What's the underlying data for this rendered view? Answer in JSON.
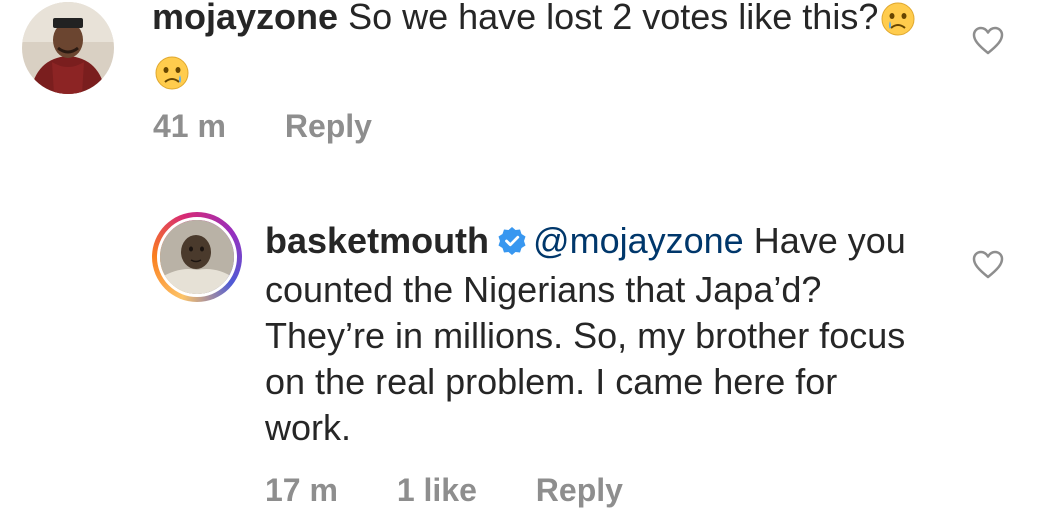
{
  "comments": [
    {
      "username": "mojayzone",
      "text": "So we have lost 2 votes like this?",
      "emojis": [
        "crying-face",
        "crying-face"
      ],
      "time": "41 m",
      "reply_label": "Reply"
    },
    {
      "username": "basketmouth",
      "verified": true,
      "mention": "@mojayzone",
      "text": "Have you counted the Nigerians that Japa’d? They’re in millions. So, my brother focus on the real problem. I came here for work.",
      "time": "17 m",
      "likes": "1 like",
      "reply_label": "Reply"
    }
  ],
  "icons": {
    "like": "heart-outline-icon",
    "verified": "verified-badge-icon"
  },
  "colors": {
    "text": "#262626",
    "meta": "#8e8e8e",
    "verified": "#3897f0",
    "heart": "#8e8e8e"
  }
}
